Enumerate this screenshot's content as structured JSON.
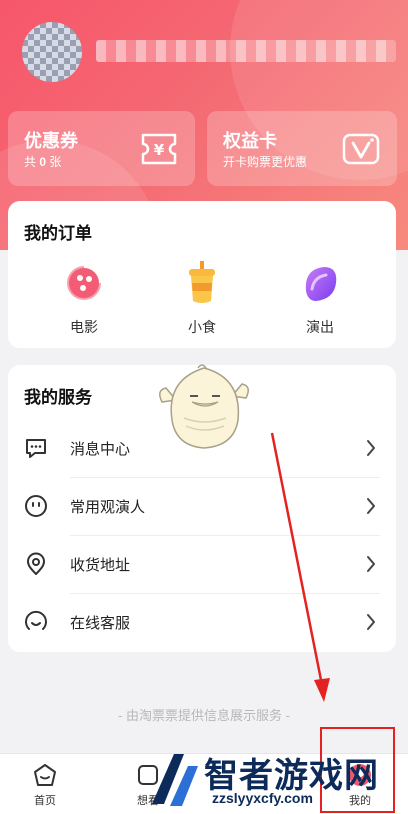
{
  "profile": {
    "nickname": ""
  },
  "cards": {
    "coupon": {
      "title": "优惠券",
      "count_prefix": "共",
      "count": "0",
      "count_suffix": "张"
    },
    "rights": {
      "title": "权益卡",
      "subtitle": "开卡购票更优惠"
    }
  },
  "orders": {
    "title": "我的订单",
    "items": [
      {
        "label": "电影",
        "icon": "film-reel-icon"
      },
      {
        "label": "小食",
        "icon": "drink-cup-icon"
      },
      {
        "label": "演出",
        "icon": "performance-icon"
      }
    ]
  },
  "services": {
    "title": "我的服务",
    "items": [
      {
        "label": "消息中心",
        "icon": "message-icon"
      },
      {
        "label": "常用观演人",
        "icon": "smile-face-icon"
      },
      {
        "label": "收货地址",
        "icon": "location-pin-icon"
      },
      {
        "label": "在线客服",
        "icon": "support-icon"
      }
    ]
  },
  "footer": {
    "note": "- 由淘票票提供信息展示服务 -"
  },
  "tabbar": {
    "items": [
      {
        "label": "首页",
        "icon": "home-icon"
      },
      {
        "label": "想看",
        "icon": "want-icon"
      },
      {
        "label": "我的",
        "icon": "profile-icon"
      }
    ]
  },
  "watermark": {
    "title": "智者游戏网",
    "url": "zzslyyxcfy.com"
  },
  "colors": {
    "accent": "#f7566a",
    "annotation": "#e52222"
  }
}
